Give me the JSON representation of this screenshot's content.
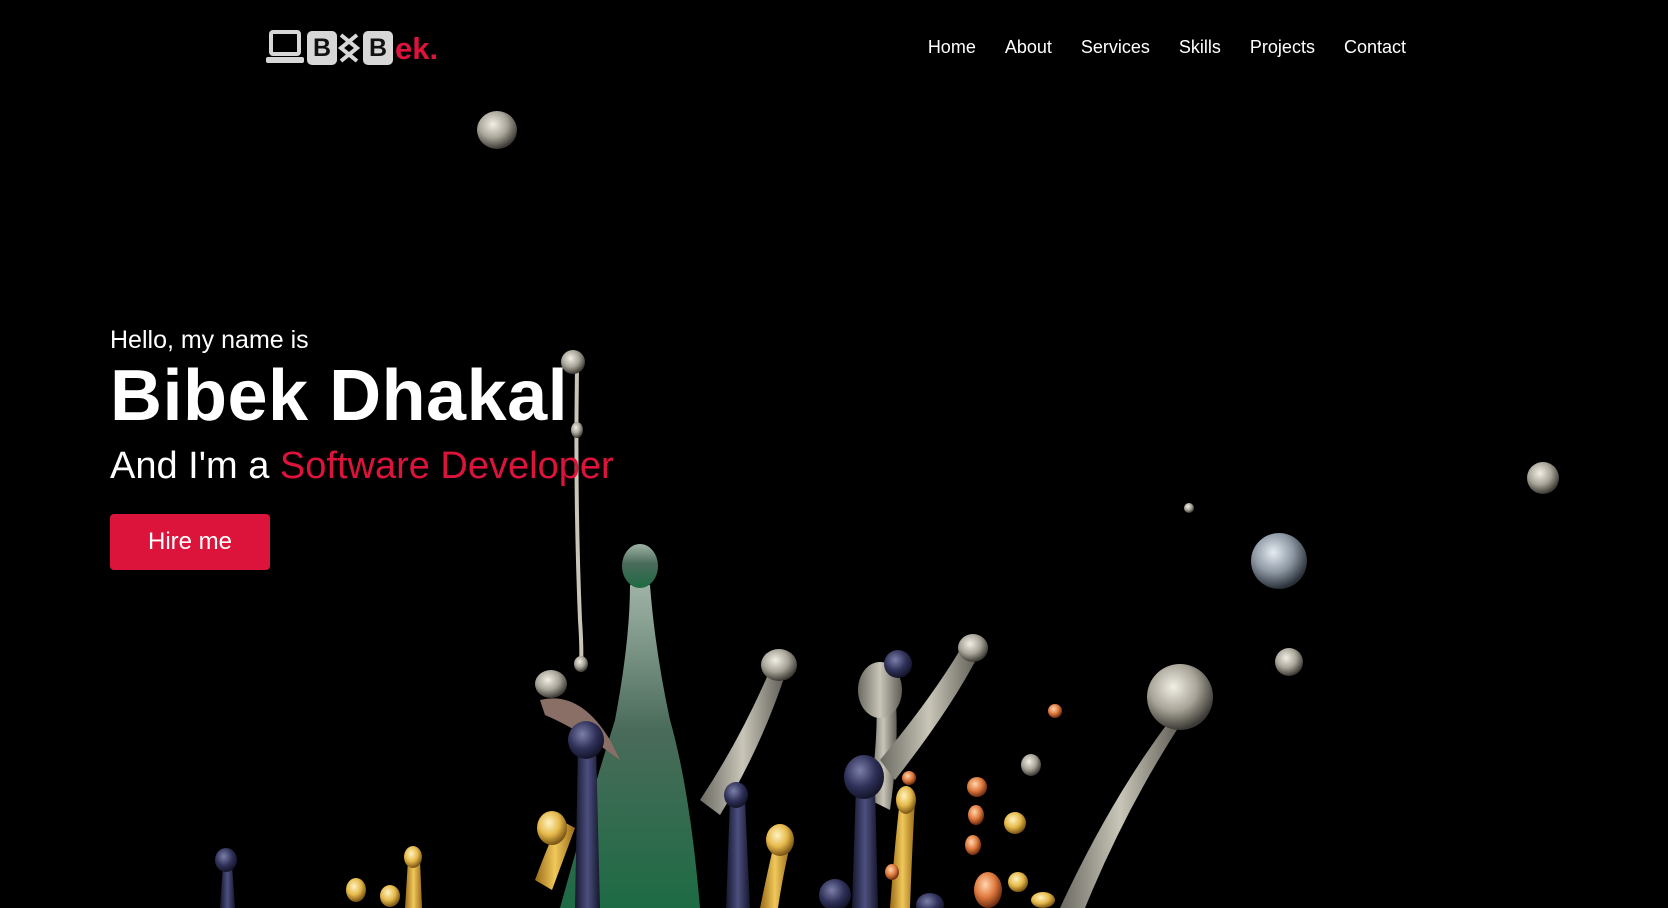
{
  "brand": {
    "box_letter_1": "B",
    "box_letter_2": "B",
    "text": "ek.",
    "accent_color": "#dc143c"
  },
  "nav": {
    "items": [
      {
        "label": "Home"
      },
      {
        "label": "About"
      },
      {
        "label": "Services"
      },
      {
        "label": "Skills"
      },
      {
        "label": "Projects"
      },
      {
        "label": "Contact"
      }
    ]
  },
  "hero": {
    "greeting": "Hello, my name is",
    "name": "Bibek Dhakal",
    "role_prefix": "And I'm a",
    "role_highlight": "Software Developer",
    "cta_label": "Hire me",
    "background_image": "colorful-paint-splash-on-black"
  }
}
